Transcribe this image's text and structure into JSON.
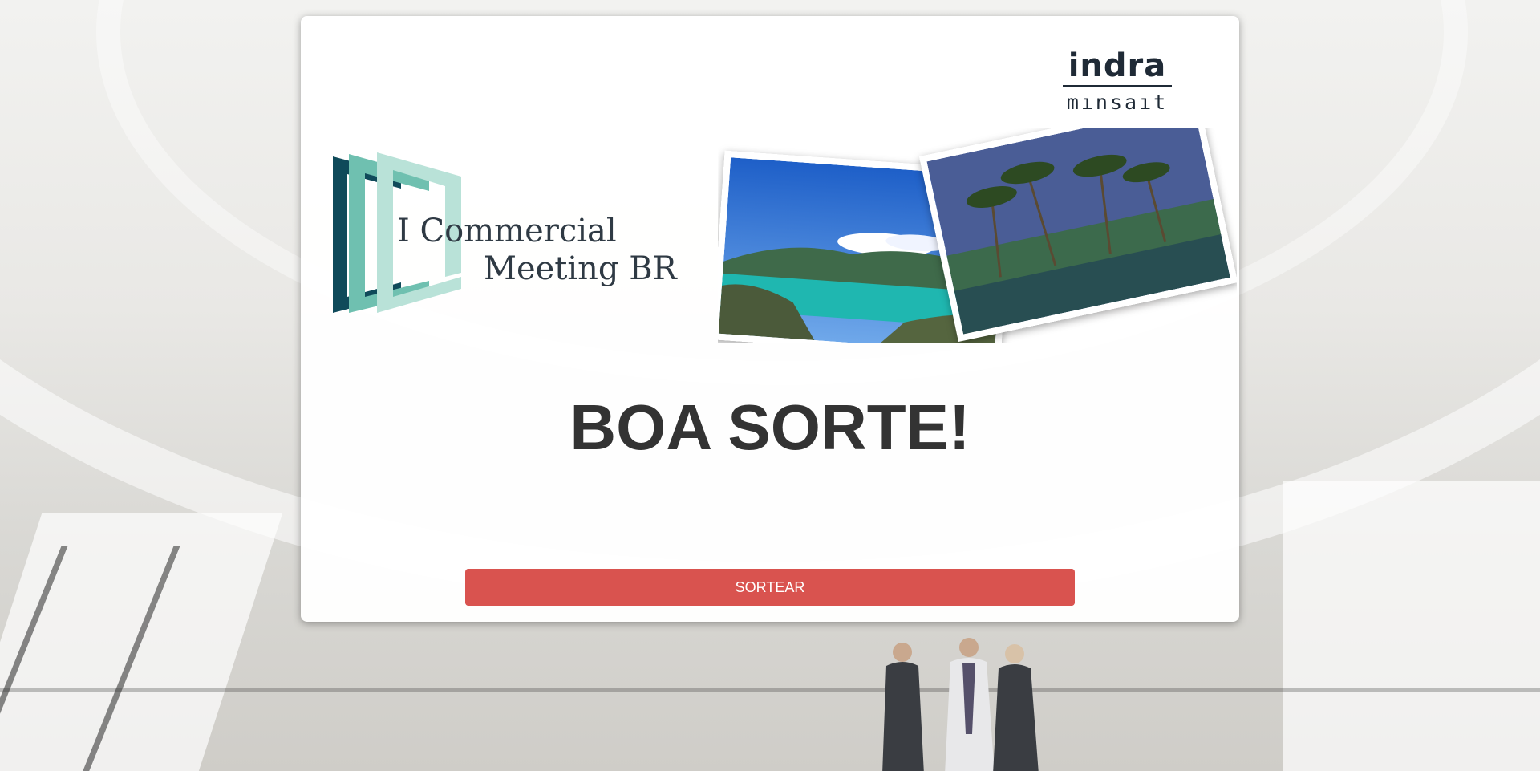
{
  "brand": {
    "top": "indra",
    "bottom": "mınsaıt"
  },
  "event": {
    "title_line_1": "I Commercial",
    "title_line_2": "Meeting BR"
  },
  "headline": "BOA SORTE!",
  "draw_button_label": "SORTEAR",
  "colors": {
    "button": "#d9534f",
    "headline": "#333333",
    "logo_dark": "#0f4a5a",
    "logo_mid": "#6fc0b0",
    "logo_light": "#b9e2d8"
  },
  "images": {
    "photo_1": "island-bay-photo",
    "photo_2": "palm-trees-pool-photo",
    "background": "office-atrium-business-people-photo"
  }
}
